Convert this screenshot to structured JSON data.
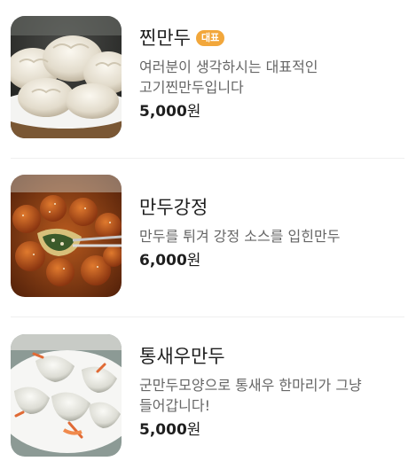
{
  "menu": {
    "items": [
      {
        "image_alt": "steamed-dumplings-photo",
        "name": "찐만두",
        "badge": "대표",
        "description": "여러분이 생각하시는 대표적인 고기찐만두입니다",
        "price": "5,000",
        "currency": "원"
      },
      {
        "image_alt": "sweet-crispy-dumplings-photo",
        "name": "만두강정",
        "badge": "",
        "description": "만두를 튀겨 강정 소스를 입힌만두",
        "price": "6,000",
        "currency": "원"
      },
      {
        "image_alt": "shrimp-dumplings-photo",
        "name": "통새우만두",
        "badge": "",
        "description": "군만두모양으로 통새우 한마리가 그냥 들어갑니다!",
        "price": "5,000",
        "currency": "원"
      }
    ]
  },
  "colors": {
    "badge_bg": "#f2a73b",
    "title": "#1e1e1e",
    "description": "#666666",
    "divider": "#efefef"
  }
}
